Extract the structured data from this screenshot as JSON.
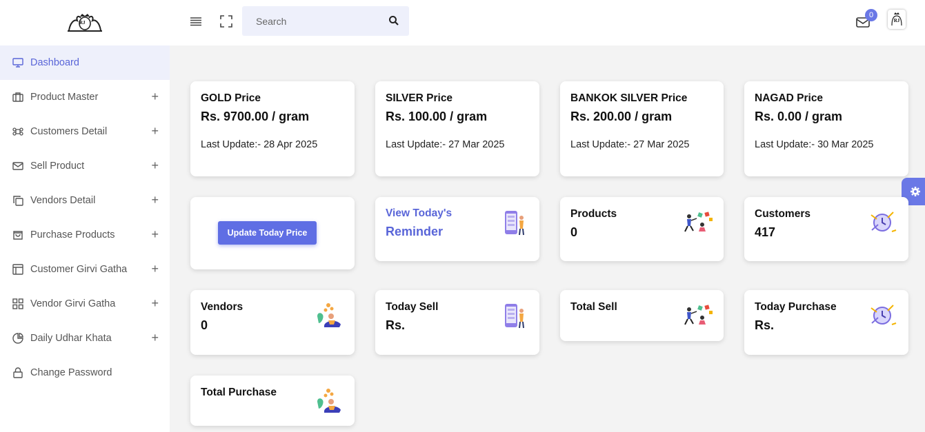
{
  "sidebar": {
    "brand_text": "RJ",
    "items": [
      {
        "label": "Dashboard",
        "icon": "monitor-icon",
        "active": true,
        "expandable": false
      },
      {
        "label": "Product Master",
        "icon": "briefcase-icon",
        "active": false,
        "expandable": true
      },
      {
        "label": "Customers Detail",
        "icon": "command-icon",
        "active": false,
        "expandable": true
      },
      {
        "label": "Sell Product",
        "icon": "mail-icon",
        "active": false,
        "expandable": true
      },
      {
        "label": "Vendors Detail",
        "icon": "copy-icon",
        "active": false,
        "expandable": true
      },
      {
        "label": "Purchase Products",
        "icon": "shopping-bag-icon",
        "active": false,
        "expandable": true
      },
      {
        "label": "Customer Girvi Gatha",
        "icon": "layout-icon",
        "active": false,
        "expandable": true
      },
      {
        "label": "Vendor Girvi Gatha",
        "icon": "grid-icon",
        "active": false,
        "expandable": true
      },
      {
        "label": "Daily Udhar Khata",
        "icon": "pie-chart-icon",
        "active": false,
        "expandable": true
      },
      {
        "label": "Change Password",
        "icon": "lock-icon",
        "active": false,
        "expandable": false
      }
    ],
    "plus_symbol": "+"
  },
  "header": {
    "search_placeholder": "Search",
    "notification_count": "0",
    "avatar_text": "RJ"
  },
  "prices": [
    {
      "title": "GOLD Price",
      "value": "Rs. 9700.00 / gram",
      "updated": "Last Update:- 28 Apr 2025"
    },
    {
      "title": "SILVER Price",
      "value": "Rs. 100.00 / gram",
      "updated": "Last Update:- 27 Mar 2025"
    },
    {
      "title": "BANKOK SILVER Price",
      "value": "Rs. 200.00 / gram",
      "updated": "Last Update:- 27 Mar 2025"
    },
    {
      "title": "NAGAD Price",
      "value": "Rs. 0.00 / gram",
      "updated": "Last Update:- 30 Mar 2025"
    }
  ],
  "update_button": "Update Today Price",
  "reminder": {
    "line1": "View Today's",
    "line2": "Reminder"
  },
  "stats": {
    "products": {
      "title": "Products",
      "value": "0"
    },
    "customers": {
      "title": "Customers",
      "value": "417"
    },
    "vendors": {
      "title": "Vendors",
      "value": "0"
    },
    "today_sell": {
      "title": "Today Sell",
      "value": "Rs."
    },
    "total_sell": {
      "title": "Total Sell",
      "value": ""
    },
    "today_purchase": {
      "title": "Today Purchase",
      "value": "Rs."
    },
    "total_purchase": {
      "title": "Total Purchase",
      "value": ""
    }
  },
  "colors": {
    "accent": "#5f6ee4",
    "active_bg": "#eef0fb",
    "active_text": "#5965d8"
  }
}
